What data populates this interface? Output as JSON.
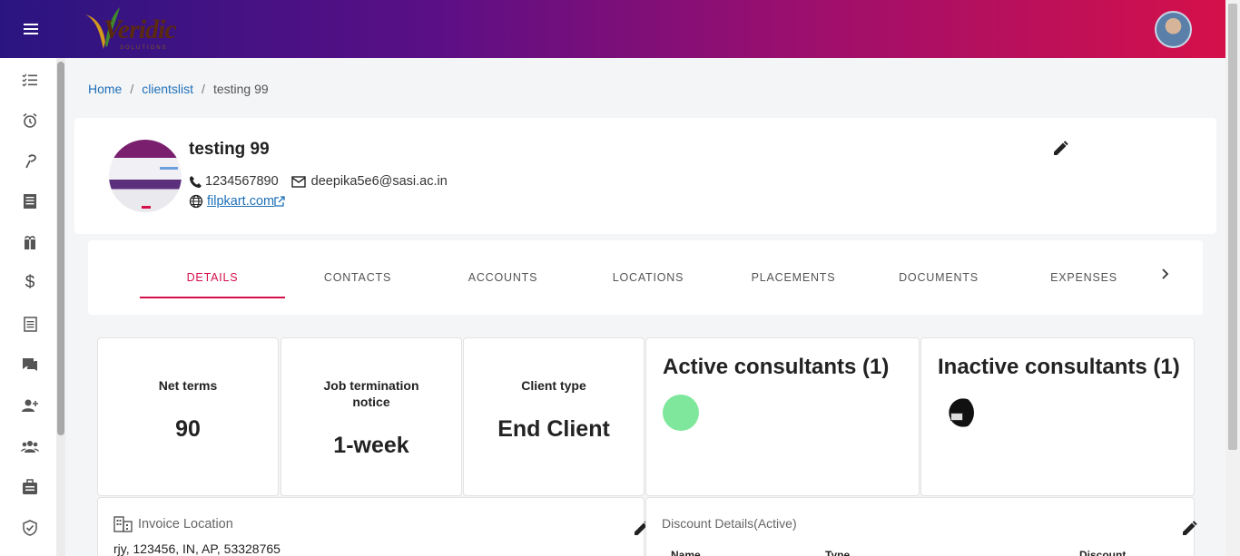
{
  "app": {
    "logo_text": "Veridic",
    "logo_subtext": "SOLUTIONS"
  },
  "sidebar": {
    "items": [
      {
        "icon": "checklist-icon"
      },
      {
        "icon": "alarm-icon"
      },
      {
        "icon": "pin-icon"
      },
      {
        "icon": "document-list-icon"
      },
      {
        "icon": "gift-icon"
      },
      {
        "icon": "dollar-icon"
      },
      {
        "icon": "notes-icon"
      },
      {
        "icon": "chat-icon"
      },
      {
        "icon": "add-user-icon"
      },
      {
        "icon": "group-icon"
      },
      {
        "icon": "briefcase-icon"
      },
      {
        "icon": "shield-check-icon"
      }
    ]
  },
  "breadcrumb": {
    "home": "Home",
    "clientslist": "clientslist",
    "current": "testing 99"
  },
  "client": {
    "name": "testing 99",
    "phone": "1234567890",
    "email": "deepika5e6@sasi.ac.in",
    "website": "filpkart.com"
  },
  "tabs": [
    "DETAILS",
    "CONTACTS",
    "ACCOUNTS",
    "LOCATIONS",
    "PLACEMENTS",
    "DOCUMENTS",
    "EXPENSES"
  ],
  "stats": {
    "net_terms_label": "Net terms",
    "net_terms_value": "90",
    "job_termination_label": "Job termination notice",
    "job_termination_value": "1-week",
    "client_type_label": "Client type",
    "client_type_value": "End Client"
  },
  "consultants": {
    "active_title": "Active consultants (1)",
    "inactive_title": "Inactive consultants (1)",
    "active_color": "#7fe79b"
  },
  "invoice": {
    "title": "Invoice Location",
    "address": "rjy, 123456, IN, AP, 53328765"
  },
  "discount": {
    "title": "Discount Details(Active)",
    "columns": [
      "Name",
      "Type",
      "Discount"
    ]
  },
  "colors": {
    "accent": "#d5104a",
    "link": "#1f70b8"
  }
}
